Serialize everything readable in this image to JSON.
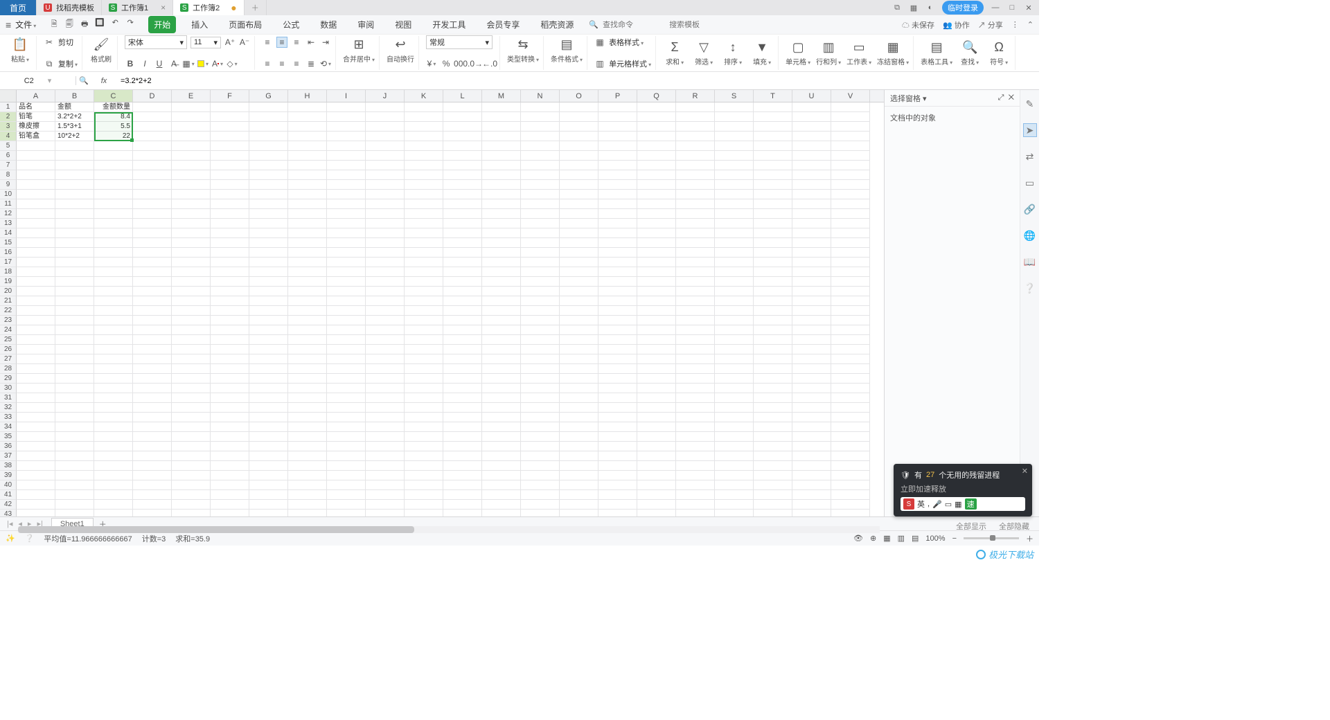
{
  "titlebar": {
    "home": "首页",
    "tabs": [
      {
        "icon": "r",
        "iconGlyph": "U",
        "label": "找稻壳模板"
      },
      {
        "icon": "g",
        "iconGlyph": "S",
        "label": "工作簿1"
      },
      {
        "icon": "g",
        "iconGlyph": "S",
        "label": "工作簿2",
        "dirty": true
      }
    ],
    "login": "临时登录"
  },
  "menubar": {
    "file": "文件",
    "tabs": [
      "开始",
      "插入",
      "页面布局",
      "公式",
      "数据",
      "审阅",
      "视图",
      "开发工具",
      "会员专享",
      "稻壳资源"
    ],
    "active": 0,
    "searchCmd": "查找命令",
    "searchTpl": "搜索模板",
    "unsaved": "未保存",
    "coop": "协作",
    "share": "分享"
  },
  "ribbon": {
    "paste": "粘贴",
    "cut": "剪切",
    "copy": "复制",
    "fmtpaint": "格式刷",
    "font": "宋体",
    "fontsize": "11",
    "merge": "合并居中",
    "wrap": "自动换行",
    "numfmt": "常规",
    "typeconv": "类型转换",
    "cond": "条件格式",
    "tblstyle": "表格样式",
    "cellstyle": "单元格样式",
    "sum": "求和",
    "filter": "筛选",
    "sort": "排序",
    "fill": "填充",
    "cells": "单元格",
    "rowcol": "行和列",
    "sheet": "工作表",
    "freeze": "冻结窗格",
    "tools": "表格工具",
    "find": "查找",
    "symbol": "符号"
  },
  "fbar": {
    "name": "C2",
    "formula": "=3.2*2+2"
  },
  "columns": [
    "A",
    "B",
    "C",
    "D",
    "E",
    "F",
    "G",
    "H",
    "I",
    "J",
    "K",
    "L",
    "M",
    "N",
    "O",
    "P",
    "Q",
    "R",
    "S",
    "T",
    "U",
    "V"
  ],
  "rowcount": 44,
  "cells": {
    "A1": "品名",
    "B1": "金额",
    "C1": "金额数量",
    "A2": "铅笔",
    "B2": "3.2*2+2",
    "C2": "8.4",
    "A3": "橡皮擦",
    "B3": "1.5*3+1",
    "C3": "5.5",
    "A4": "铅笔盒",
    "B4": "10*2+2",
    "C4": "22"
  },
  "selection": {
    "col": 2,
    "rowStart": 2,
    "rowEnd": 4
  },
  "rightpane": {
    "title": "选择窗格",
    "body": "文档中的对象"
  },
  "sheettabs": {
    "name": "Sheet1"
  },
  "status": {
    "avg": "平均值=11.966666666667",
    "count": "计数=3",
    "sum": "求和=35.9",
    "zoom": "100%"
  },
  "toast": {
    "pre": "有 ",
    "num": "27",
    "post": " 个无用的残留进程",
    "sub": "立即加速释放",
    "ime": "英"
  },
  "botlinks": {
    "showall": "全部显示",
    "hideall": "全部隐藏"
  },
  "watermark": "极光下载站"
}
